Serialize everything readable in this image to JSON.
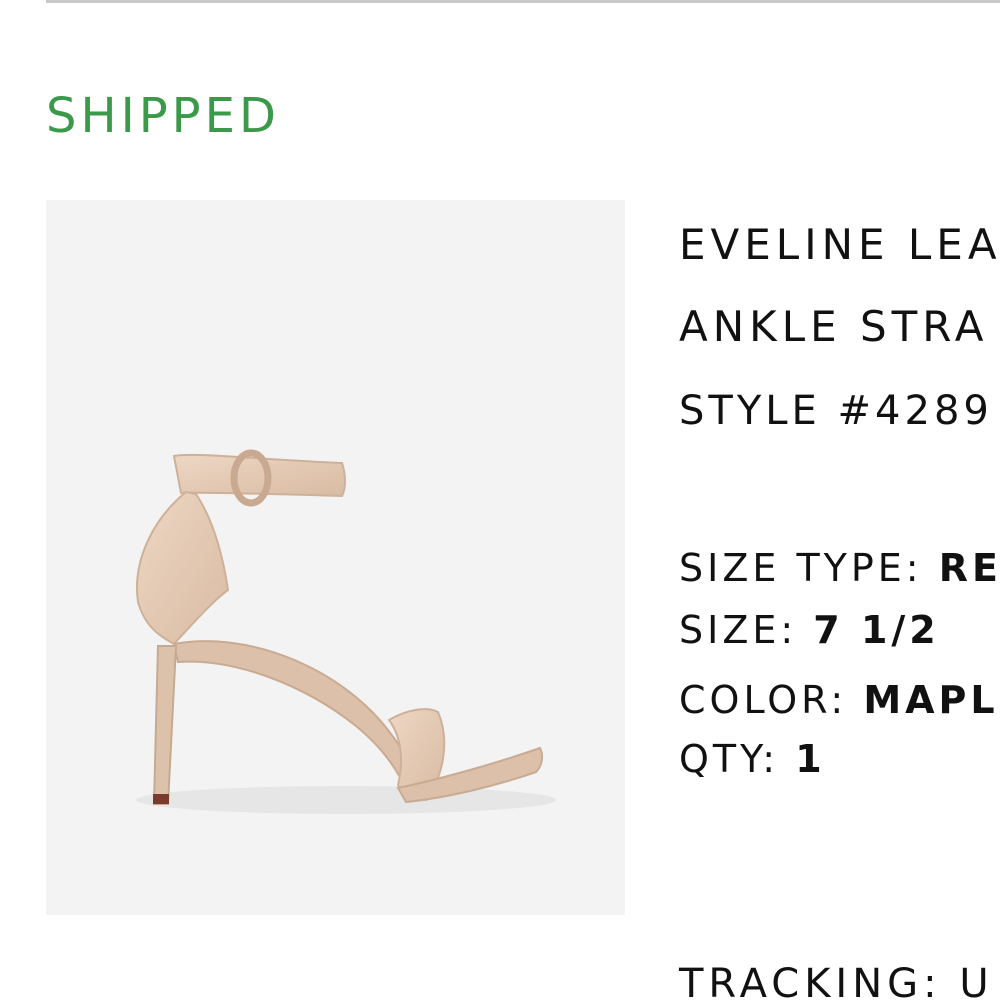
{
  "order_item": {
    "status": "SHIPPED",
    "status_color": "#3b9a4a",
    "image": {
      "icon": "ankle-strap-heel-sandal",
      "background": "#f3f3f3",
      "shoe_color": "#e3c8b1"
    },
    "name_line1": "EVELINE LEA",
    "name_line2": "ANKLE STRA",
    "style": "STYLE #4289",
    "size_type_label": "SIZE TYPE:",
    "size_type_value": "RE",
    "size_label": "SIZE:",
    "size_value": "7 1/2",
    "color_label": "COLOR:",
    "color_value": "MAPL",
    "qty_label": "QTY:",
    "qty_value": "1",
    "tracking": "TRACKING: U"
  }
}
